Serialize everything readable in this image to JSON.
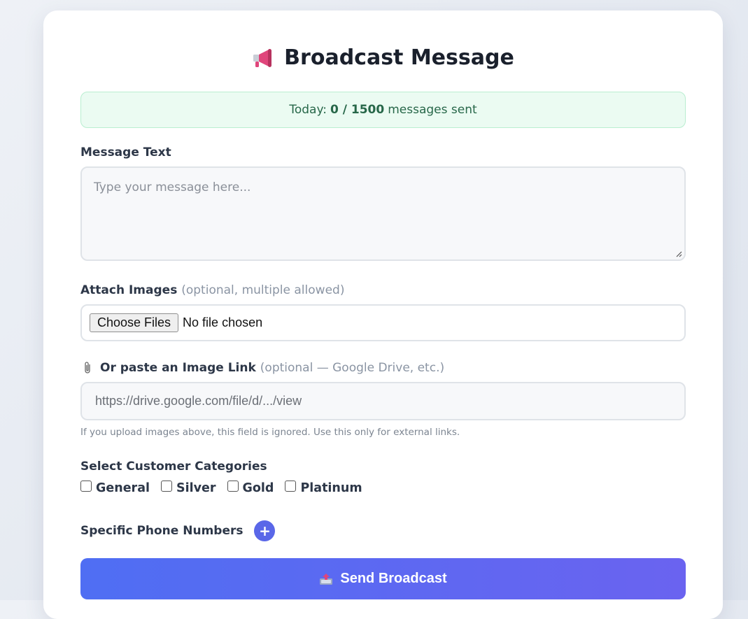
{
  "page": {
    "title": "Broadcast Message",
    "title_icon": "megaphone-icon"
  },
  "stats": {
    "prefix": "Today:",
    "count": "0 / 1500",
    "suffix": "messages sent"
  },
  "message": {
    "label": "Message Text",
    "placeholder": "Type your message here..."
  },
  "images": {
    "label": "Attach Images",
    "note": "(optional, multiple allowed)",
    "button_label": "Choose Files",
    "status": "No file chosen"
  },
  "image_link": {
    "icon": "paperclip-icon",
    "label": "Or paste an Image Link",
    "note": "(optional — Google Drive, etc.)",
    "placeholder": "https://drive.google.com/file/d/.../view",
    "hint": "If you upload images above, this field is ignored. Use this only for external links."
  },
  "categories": {
    "label": "Select Customer Categories",
    "options": [
      {
        "label": "General",
        "checked": false
      },
      {
        "label": "Silver",
        "checked": false
      },
      {
        "label": "Gold",
        "checked": false
      },
      {
        "label": "Platinum",
        "checked": false
      }
    ]
  },
  "phones": {
    "label": "Specific Phone Numbers",
    "add_label": "+"
  },
  "send": {
    "icon": "outbox-tray-icon",
    "label": "Send Broadcast"
  },
  "colors": {
    "accent": "#5a67e8",
    "stats_bg": "#ebfbf2",
    "stats_text": "#276749"
  }
}
